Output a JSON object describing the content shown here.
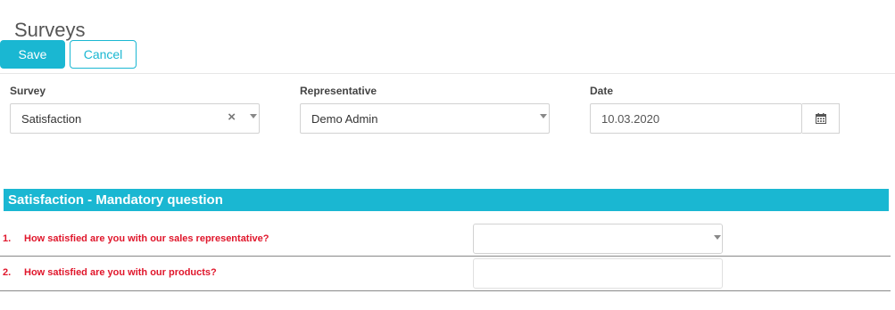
{
  "page": {
    "title": "Surveys"
  },
  "toolbar": {
    "save_label": "Save",
    "cancel_label": "Cancel"
  },
  "form": {
    "survey": {
      "label": "Survey",
      "value": "Satisfaction",
      "clear_icon": "×"
    },
    "representative": {
      "label": "Representative",
      "value": "Demo Admin"
    },
    "date": {
      "label": "Date",
      "value": "10.03.2020"
    }
  },
  "section": {
    "title": "Satisfaction - Mandatory question",
    "questions": [
      {
        "number": "1.",
        "text": "How satisfied are you with our sales representative?",
        "answer_type": "select",
        "value": ""
      },
      {
        "number": "2.",
        "text": "How satisfied are you with our products?",
        "answer_type": "text",
        "value": ""
      }
    ]
  },
  "colors": {
    "accent": "#1ab7d2",
    "question_text": "#e0162b"
  },
  "icons": {
    "dropdown": "chevron-down-icon",
    "clear": "clear-icon",
    "calendar": "calendar-icon"
  }
}
